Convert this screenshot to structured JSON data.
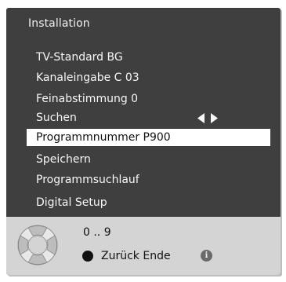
{
  "osd": {
    "title": "Installation",
    "menu": [
      {
        "label": "TV-Standard BG"
      },
      {
        "label": "Kanaleingabe C 03"
      },
      {
        "label": "Feinabstimmung 0"
      },
      {
        "label": "Suchen"
      },
      {
        "label": "Programmnummer P900",
        "selected": true
      },
      {
        "label": "Speichern"
      },
      {
        "label": "Programmsuchlauf"
      },
      {
        "label": "Digital Setup"
      }
    ],
    "search_arrows": [
      "arrow-left-icon",
      "arrow-right-icon"
    ]
  },
  "help": {
    "digits": "0 .. 9",
    "back_label": "Zurück Ende",
    "info_icon_glyph": "i",
    "remote_icon": "remote-navigation-pad-icon",
    "back_button_color": "#111111"
  },
  "colors": {
    "osd_background": "#3f3f3f",
    "help_background": "#d4d4d4",
    "selection_background": "#ffffff",
    "text_light": "#f7f7f7"
  }
}
